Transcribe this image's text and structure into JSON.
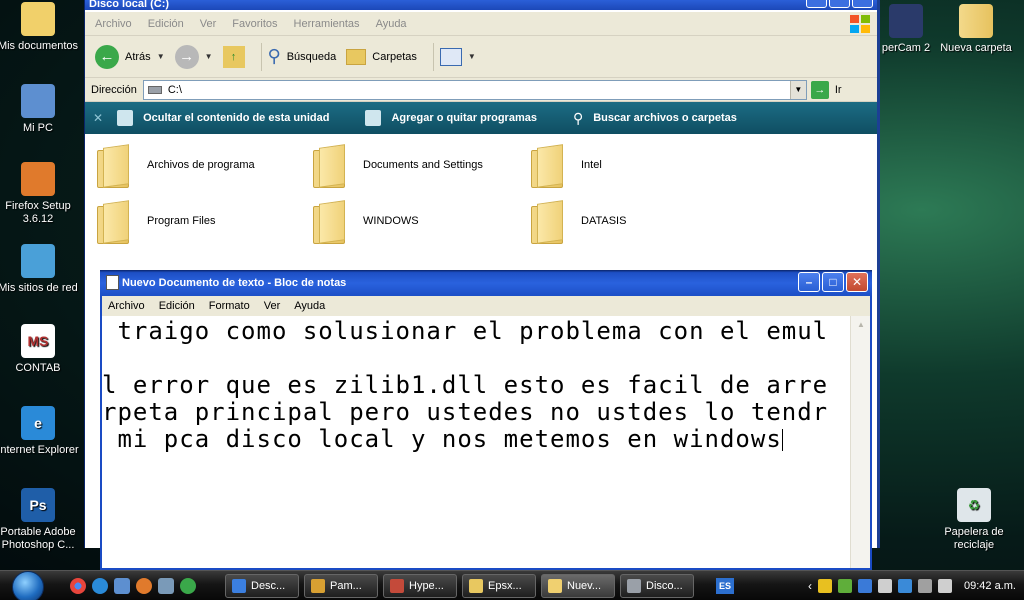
{
  "desktop": {
    "left_icons": [
      {
        "label": "Mis documentos",
        "glyph": "",
        "color": "#f1d06a"
      },
      {
        "label": "Mi PC",
        "glyph": "",
        "color": "#5d8fd0"
      },
      {
        "label": "Firefox Setup 3.6.12",
        "glyph": "",
        "color": "#e07a2c"
      },
      {
        "label": "Mis sitios de red",
        "glyph": "",
        "color": "#4aa0d8"
      },
      {
        "label": "CONTAB",
        "glyph": "MS",
        "color": "#ffffff"
      },
      {
        "label": "Internet Explorer",
        "glyph": "e",
        "color": "#2a8ad8"
      },
      {
        "label": "Portable Adobe Photoshop C...",
        "glyph": "Ps",
        "color": "#1f5ea8"
      }
    ],
    "right_icons": [
      {
        "label": "perCam 2"
      },
      {
        "label": "Nueva carpeta"
      },
      {
        "label": "Papelera de reciclaje"
      }
    ]
  },
  "explorer": {
    "title": "Disco local (C:)",
    "menu": [
      "Archivo",
      "Edición",
      "Ver",
      "Favoritos",
      "Herramientas",
      "Ayuda"
    ],
    "toolbar": {
      "back": "Atrás",
      "search": "Búsqueda",
      "folders": "Carpetas"
    },
    "address_label": "Dirección",
    "address_value": "C:\\",
    "go_label": "Ir",
    "tasks": [
      "Ocultar el contenido de esta unidad",
      "Agregar o quitar programas",
      "Buscar archivos o carpetas"
    ],
    "folders": [
      "Archivos de programa",
      "Documents and Settings",
      "Intel",
      "Program Files",
      "WINDOWS",
      "DATASIS"
    ]
  },
  "notepad": {
    "title": "Nuevo Documento de texto - Bloc de notas",
    "menu": [
      "Archivo",
      "Edición",
      "Formato",
      "Ver",
      "Ayuda"
    ],
    "lines": [
      " traigo como solusionar el problema con el emul",
      "",
      "l error que es zilib1.dll esto es facil de arre",
      "rpeta principal pero ustedes no ustdes lo tendr",
      " mi pca disco local y nos metemos en windows"
    ]
  },
  "taskbar": {
    "tasks": [
      {
        "label": "Desc...",
        "color": "#3b7fe0"
      },
      {
        "label": "Pam...",
        "color": "#d8a032"
      },
      {
        "label": "Hype...",
        "color": "#c44a3a"
      },
      {
        "label": "Epsx...",
        "color": "#e8c860"
      },
      {
        "label": "Nuev...",
        "color": "#f0d070"
      },
      {
        "label": "Disco...",
        "color": "#9aa0a8"
      }
    ],
    "language": "ES",
    "clock": "09:42 a.m."
  }
}
